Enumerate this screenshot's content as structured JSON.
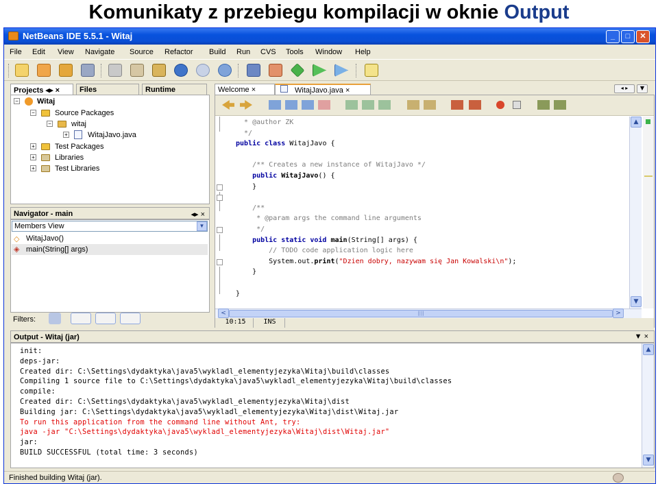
{
  "slide_title": {
    "part1": "Komunikaty z przebiegu kompilacji w oknie ",
    "part2": "Output"
  },
  "window": {
    "title": "NetBeans IDE 5.5.1 - Witaj",
    "min": "_",
    "max": "□",
    "close": "✕"
  },
  "menu": [
    "File",
    "Edit",
    "View",
    "Navigate",
    "Source",
    "Refactor",
    "Build",
    "Run",
    "CVS",
    "Tools",
    "Window",
    "Help"
  ],
  "projects_panel": {
    "tabs": [
      "Projects ◂▸ ×",
      "Files",
      "Runtime"
    ],
    "tree": [
      {
        "label": "Witaj",
        "bold": true
      },
      {
        "label": "Source Packages"
      },
      {
        "label": "witaj"
      },
      {
        "label": "WitajJavo.java"
      },
      {
        "label": "Test Packages"
      },
      {
        "label": "Libraries"
      },
      {
        "label": "Test Libraries"
      }
    ]
  },
  "navigator": {
    "title": "Navigator - main",
    "controls": "◂▸ ×",
    "view": "Members View",
    "items": [
      "WitajJavo()",
      "main(String[] args)"
    ],
    "filters_label": "Filters:"
  },
  "editor": {
    "tabs": [
      "Welcome ×",
      "WitajJavo.java ×"
    ],
    "status_pos": "10:15",
    "status_mode": "INS",
    "scroll_left": "<",
    "scroll_right": ">",
    "scroll_grip": "||||",
    "lines": [
      {
        "segments": [
          {
            "t": "  * @author ZK",
            "c": "cm"
          }
        ]
      },
      {
        "segments": [
          {
            "t": "  */",
            "c": "cm"
          }
        ]
      },
      {
        "segments": [
          {
            "t": "public class ",
            "c": "kw"
          },
          {
            "t": "WitajJavo {",
            "c": ""
          }
        ]
      },
      {
        "segments": [
          {
            "t": "",
            "c": ""
          }
        ]
      },
      {
        "segments": [
          {
            "t": "    /** Creates a new instance of WitajJavo */",
            "c": "cm"
          }
        ]
      },
      {
        "segments": [
          {
            "t": "    public ",
            "c": "kw"
          },
          {
            "t": "WitajJavo",
            "c": "b"
          },
          {
            "t": "() {",
            "c": ""
          }
        ]
      },
      {
        "segments": [
          {
            "t": "    }",
            "c": ""
          }
        ]
      },
      {
        "segments": [
          {
            "t": "",
            "c": ""
          }
        ]
      },
      {
        "segments": [
          {
            "t": "    /**",
            "c": "cm"
          }
        ]
      },
      {
        "segments": [
          {
            "t": "     * @param args the command line arguments",
            "c": "cm"
          }
        ]
      },
      {
        "segments": [
          {
            "t": "     */",
            "c": "cm"
          }
        ]
      },
      {
        "segments": [
          {
            "t": "    public static void ",
            "c": "kw"
          },
          {
            "t": "main",
            "c": "b"
          },
          {
            "t": "(String[] args) {",
            "c": ""
          }
        ]
      },
      {
        "segments": [
          {
            "t": "        // TODO code application logic here",
            "c": "cm"
          }
        ]
      },
      {
        "segments": [
          {
            "t": "        System.out.",
            "c": ""
          },
          {
            "t": "print",
            "c": "b"
          },
          {
            "t": "(",
            "c": ""
          },
          {
            "t": "\"Dzien dobry, nazywam się Jan Kowalski\\n\"",
            "c": "str"
          },
          {
            "t": ");",
            "c": ""
          }
        ]
      },
      {
        "segments": [
          {
            "t": "    }",
            "c": ""
          }
        ]
      },
      {
        "segments": [
          {
            "t": "",
            "c": ""
          }
        ]
      },
      {
        "segments": [
          {
            "t": "}",
            "c": ""
          }
        ]
      }
    ]
  },
  "output": {
    "title": "Output - Witaj (jar)",
    "controls": "▼ ×",
    "lines": [
      {
        "text": "init:",
        "red": false
      },
      {
        "text": "deps-jar:",
        "red": false
      },
      {
        "text": "Created dir: C:\\Settings\\dydaktyka\\java5\\wykladl_elementyjezyka\\Witaj\\build\\classes",
        "red": false
      },
      {
        "text": "Compiling 1 source file to C:\\Settings\\dydaktyka\\java5\\wykladl_elementyjezyka\\Witaj\\build\\classes",
        "red": false
      },
      {
        "text": "compile:",
        "red": false
      },
      {
        "text": "Created dir: C:\\Settings\\dydaktyka\\java5\\wykladl_elementyjezyka\\Witaj\\dist",
        "red": false
      },
      {
        "text": "Building jar: C:\\Settings\\dydaktyka\\java5\\wykladl_elementyjezyka\\Witaj\\dist\\Witaj.jar",
        "red": false
      },
      {
        "text": "To run this application from the command line without Ant, try:",
        "red": true
      },
      {
        "text": "java -jar \"C:\\Settings\\dydaktyka\\java5\\wykladl_elementyjezyka\\Witaj\\dist\\Witaj.jar\"",
        "red": true
      },
      {
        "text": "jar:",
        "red": false
      },
      {
        "text": "BUILD SUCCESSFUL (total time: 3 seconds)",
        "red": false
      }
    ]
  },
  "status_bar": "Finished building Witaj (jar).",
  "colors": {
    "titlebar": "#0852dd",
    "keyword": "#0000a0",
    "comment": "#7d7d7d",
    "string": "#c80000",
    "output_red": "#e00000"
  }
}
